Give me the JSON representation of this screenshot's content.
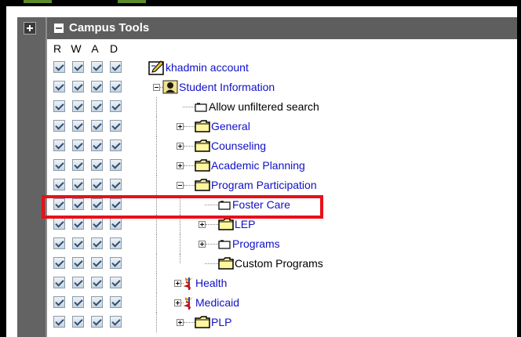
{
  "header": {
    "title": "Campus Tools"
  },
  "columns": [
    "R",
    "W",
    "A",
    "D"
  ],
  "tree": [
    {
      "label": "khadmin account",
      "color": "blue",
      "icon": "account-icon"
    },
    {
      "label": "Student Information",
      "color": "blue",
      "icon": "student-icon",
      "expanded": true
    },
    {
      "label": "Allow unfiltered search",
      "color": "black",
      "icon": "page-icon"
    },
    {
      "label": "General",
      "color": "blue",
      "icon": "folder-icon"
    },
    {
      "label": "Counseling",
      "color": "blue",
      "icon": "folder-icon"
    },
    {
      "label": "Academic Planning",
      "color": "blue",
      "icon": "folder-icon"
    },
    {
      "label": "Program Participation",
      "color": "blue",
      "icon": "folder-icon",
      "expanded": true
    },
    {
      "label": "Foster Care",
      "color": "blue",
      "icon": "page-icon",
      "highlighted": true
    },
    {
      "label": "LEP",
      "color": "blue",
      "icon": "folder-icon"
    },
    {
      "label": "Programs",
      "color": "blue",
      "icon": "page-icon"
    },
    {
      "label": "Custom Programs",
      "color": "black",
      "icon": "folder-icon"
    },
    {
      "label": "Health",
      "color": "blue",
      "icon": "caduceus-icon"
    },
    {
      "label": "Medicaid",
      "color": "blue",
      "icon": "caduceus-icon"
    },
    {
      "label": "PLP",
      "color": "blue",
      "icon": "folder-icon"
    }
  ],
  "colors": {
    "header_bg": "#5e5e5e",
    "link": "#1010c8",
    "highlight": "#e8101a"
  }
}
